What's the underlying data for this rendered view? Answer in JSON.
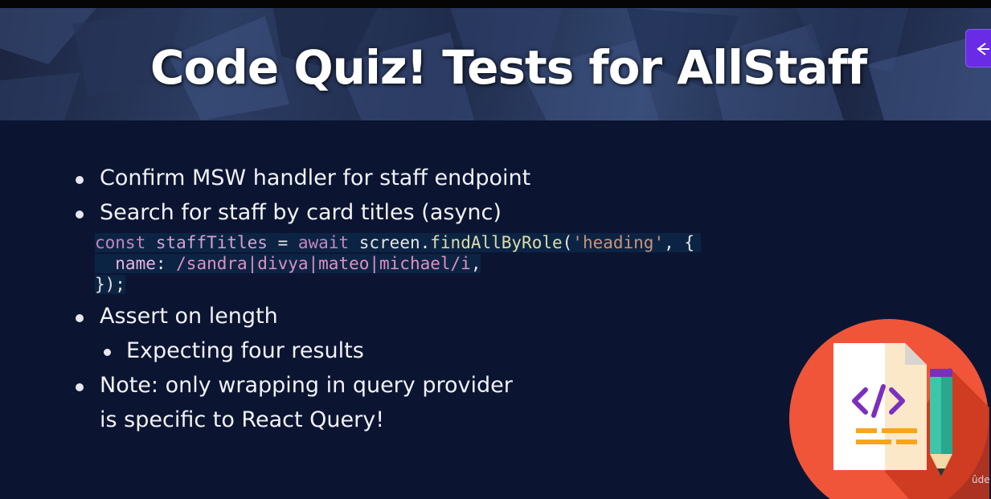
{
  "slide": {
    "title": "Code Quiz! Tests for AllStaff",
    "bullets": [
      "Confirm MSW handler for staff endpoint",
      "Search for staff by card titles (async)",
      "Assert on length",
      "Expecting four results",
      "Note: only wrapping in query provider",
      "is specific to React Query!"
    ],
    "code": {
      "line1": {
        "kw": "const",
        "var": "staffTitles",
        "op": " = ",
        "await": "await",
        "obj": " screen.",
        "fn": "findAllByRole",
        "open": "(",
        "str": "'heading'",
        "close": ", {"
      },
      "line2": {
        "prop": "  name",
        "colon": ": ",
        "regex": "/sandra|divya|mateo|michael/i",
        "comma": ","
      },
      "line3": "});"
    }
  },
  "watermark": "ûde",
  "colors": {
    "background": "#0b1532",
    "accent_button": "#6a2be6",
    "circle": "#f0553a"
  },
  "icons": {
    "nav": "arrow-left-icon",
    "illustration": "code-file-pencil-icon"
  }
}
